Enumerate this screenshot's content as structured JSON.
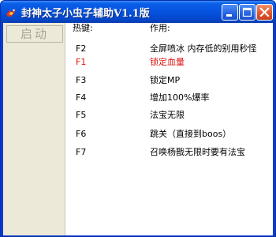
{
  "window": {
    "title": "封神太子小虫子辅助V1.1版"
  },
  "titlebar": {
    "icons": [
      "app-icon",
      "minimize-icon",
      "maximize-icon",
      "close-icon"
    ]
  },
  "sidebar": {
    "start_label": "启动"
  },
  "list": {
    "headers": {
      "key": "热键:",
      "action": "作用:"
    },
    "rows": [
      {
        "key": "F2",
        "action": "全屏喷冰 内存低的别用秒怪"
      },
      {
        "key": "F1",
        "action": "锁定血量",
        "color": "#e21010"
      },
      {
        "key": "F3",
        "action": "锁定MP"
      },
      {
        "key": "F4",
        "action": "增加100%爆率"
      },
      {
        "key": "F5",
        "action": "法宝无限"
      },
      {
        "key": "F6",
        "action": "跳关（直接到boos）"
      },
      {
        "key": "F7",
        "action": "召唤杨戬无限时要有法宝"
      }
    ]
  },
  "colors": {
    "titlebar": "#0652e0",
    "close_button": "#e2572b",
    "highlight_text": "#e21010",
    "panel_bg": "#ece9d8"
  }
}
